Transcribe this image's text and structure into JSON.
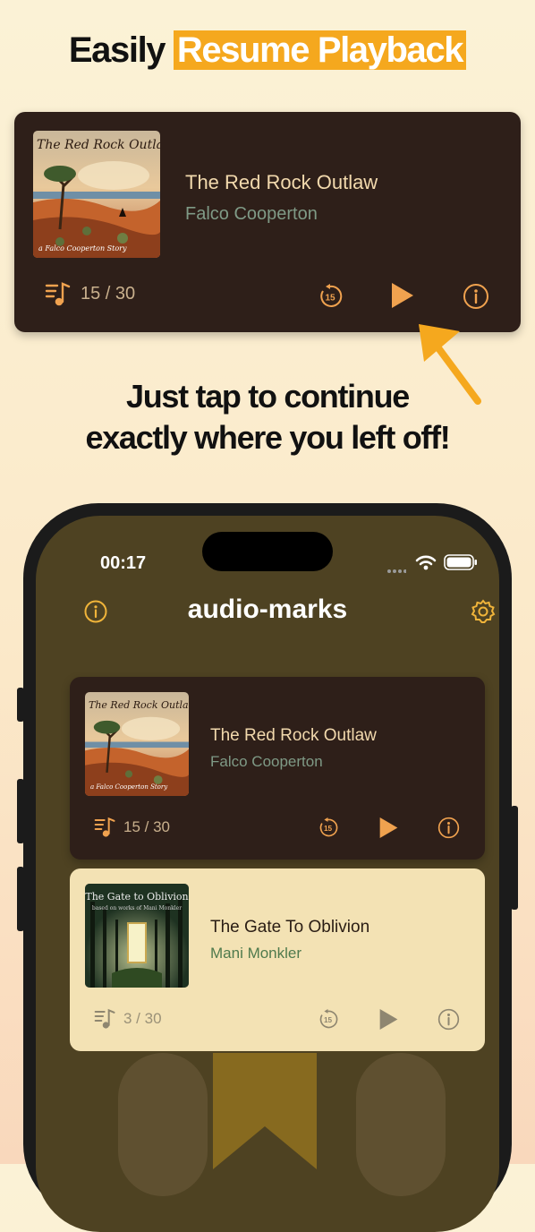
{
  "headline": {
    "prefix": "Easily ",
    "highlight": "Resume Playback"
  },
  "subhead": {
    "line1": "Just tap to continue",
    "line2": "exactly where you left off!"
  },
  "colors": {
    "accent": "#f5a81e",
    "card_dark": "#2e1f19",
    "card_light": "#f3e2b4",
    "app_bg": "#4e4222"
  },
  "promo_card": {
    "title": "The Red Rock Outlaw",
    "author": "Falco Cooperton",
    "cover_title": "The Red Rock Outlaw",
    "cover_subtitle": "a Falco Cooperton Story",
    "progress": "15 / 30",
    "icons": [
      "track-list-icon",
      "rewind-15-icon",
      "play-icon",
      "info-icon"
    ]
  },
  "phone": {
    "status": {
      "time": "00:17"
    },
    "app_title": "audio-marks",
    "icons": [
      "info-icon",
      "settings-icon"
    ],
    "books": [
      {
        "title": "The Red Rock Outlaw",
        "author": "Falco Cooperton",
        "cover_title": "The Red Rock Outlaw",
        "cover_subtitle": "a Falco Cooperton Story",
        "progress": "15 / 30"
      },
      {
        "title": "The Gate To Oblivion",
        "author": "Mani Monkler",
        "cover_title": "The Gate to Oblivion",
        "cover_subtitle": "based on works of Mani Monkler",
        "progress": "3 / 30"
      }
    ]
  }
}
